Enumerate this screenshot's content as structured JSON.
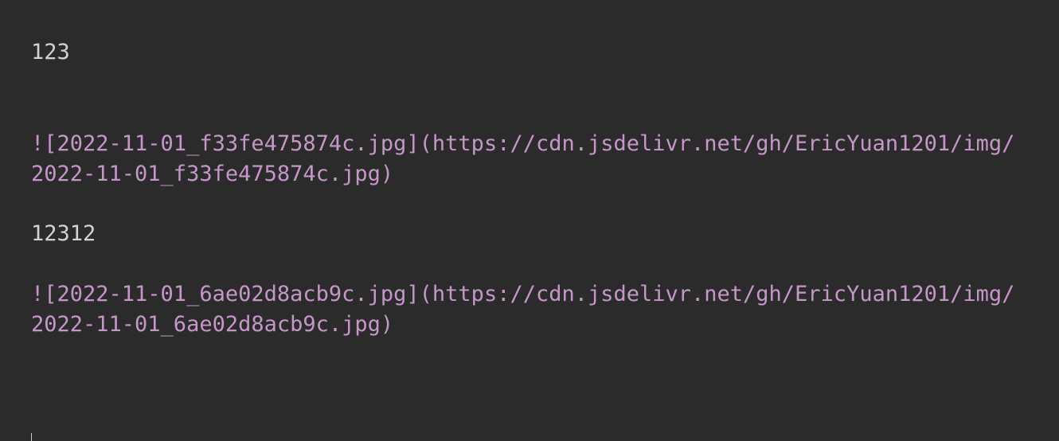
{
  "editor": {
    "lines": [
      "123",
      "![2022-11-01_f33fe475874c.jpg](https://cdn.jsdelivr.net/gh/EricYuan1201/img/",
      "2022-11-01_f33fe475874c.jpg)",
      "12312",
      "![2022-11-01_6ae02d8acb9c.jpg](https://cdn.jsdelivr.net/gh/EricYuan1201/img/",
      "2022-11-01_6ae02d8acb9c.jpg)"
    ],
    "colors": {
      "background": "#2b2b2b",
      "text": "#d2d2d2",
      "markdown_image": "#c597c9"
    }
  }
}
